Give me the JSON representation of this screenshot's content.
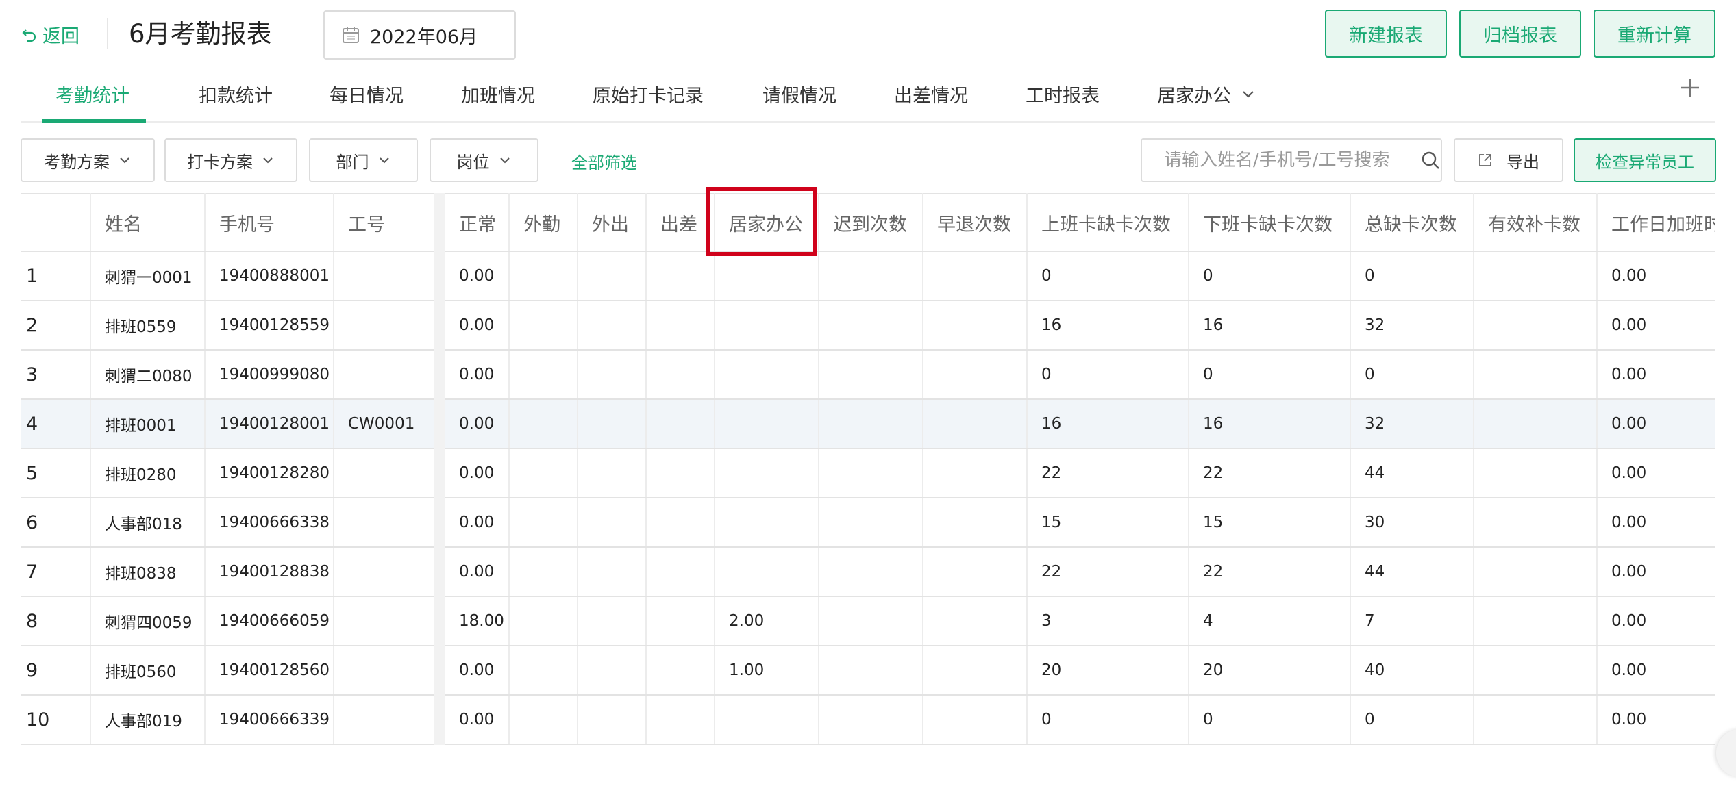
{
  "header": {
    "back_label": "返回",
    "title": "6月考勤报表",
    "month": "2022年06月",
    "buttons": [
      "新建报表",
      "归档报表",
      "重新计算"
    ]
  },
  "tabs": [
    "考勤统计",
    "扣款统计",
    "每日情况",
    "加班情况",
    "原始打卡记录",
    "请假情况",
    "出差情况",
    "工时报表",
    "居家办公"
  ],
  "active_tab": 0,
  "filters": {
    "dropdowns": [
      "考勤方案",
      "打卡方案",
      "部门",
      "岗位"
    ],
    "all_filter": "全部筛选",
    "search_placeholder": "请输入姓名/手机号/工号搜索",
    "export_label": "导出",
    "check_label": "检查异常员工"
  },
  "table": {
    "columns": [
      "",
      "姓名",
      "手机号",
      "工号",
      "正常",
      "外勤",
      "外出",
      "出差",
      "居家办公",
      "迟到次数",
      "早退次数",
      "上班卡缺卡次数",
      "下班卡缺卡次数",
      "总缺卡次数",
      "有效补卡数",
      "工作日加班时长"
    ],
    "rows": [
      [
        "1",
        "刺猬一0001",
        "19400888001",
        "",
        "0.00",
        "",
        "",
        "",
        "",
        "",
        "",
        "0",
        "0",
        "0",
        "",
        "0.00"
      ],
      [
        "2",
        "排班0559",
        "19400128559",
        "",
        "0.00",
        "",
        "",
        "",
        "",
        "",
        "",
        "16",
        "16",
        "32",
        "",
        "0.00"
      ],
      [
        "3",
        "刺猬二0080",
        "19400999080",
        "",
        "0.00",
        "",
        "",
        "",
        "",
        "",
        "",
        "0",
        "0",
        "0",
        "",
        "0.00"
      ],
      [
        "4",
        "排班0001",
        "19400128001",
        "CW0001",
        "0.00",
        "",
        "",
        "",
        "",
        "",
        "",
        "16",
        "16",
        "32",
        "",
        "0.00"
      ],
      [
        "5",
        "排班0280",
        "19400128280",
        "",
        "0.00",
        "",
        "",
        "",
        "",
        "",
        "",
        "22",
        "22",
        "44",
        "",
        "0.00"
      ],
      [
        "6",
        "人事部018",
        "19400666338",
        "",
        "0.00",
        "",
        "",
        "",
        "",
        "",
        "",
        "15",
        "15",
        "30",
        "",
        "0.00"
      ],
      [
        "7",
        "排班0838",
        "19400128838",
        "",
        "0.00",
        "",
        "",
        "",
        "",
        "",
        "",
        "22",
        "22",
        "44",
        "",
        "0.00"
      ],
      [
        "8",
        "刺猬四0059",
        "19400666059",
        "",
        "18.00",
        "",
        "",
        "",
        "2.00",
        "",
        "",
        "3",
        "4",
        "7",
        "",
        "0.00"
      ],
      [
        "9",
        "排班0560",
        "19400128560",
        "",
        "0.00",
        "",
        "",
        "",
        "1.00",
        "",
        "",
        "20",
        "20",
        "40",
        "",
        "0.00"
      ],
      [
        "10",
        "人事部019",
        "19400666339",
        "",
        "0.00",
        "",
        "",
        "",
        "",
        "",
        "",
        "0",
        "0",
        "0",
        "",
        "0.00"
      ]
    ],
    "highlighted_row": 3
  },
  "colors": {
    "accent": "#1aa974",
    "highlight_box": "#d0021b",
    "row_highlight": "#f1f5f9"
  }
}
